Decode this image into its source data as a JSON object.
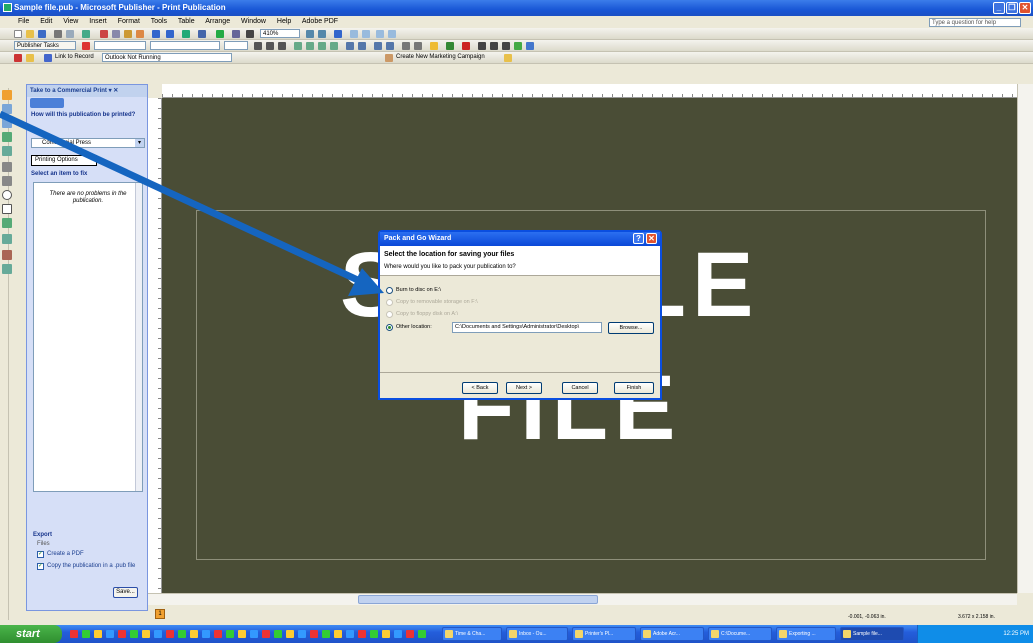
{
  "window": {
    "title": "Sample file.pub - Microsoft Publisher - Print Publication"
  },
  "menu": [
    "File",
    "Edit",
    "View",
    "Insert",
    "Format",
    "Tools",
    "Table",
    "Arrange",
    "Window",
    "Help",
    "Adobe PDF"
  ],
  "help_box": {
    "placeholder": "Type a question for help"
  },
  "toolbar": {
    "zoom": "410%",
    "publisher_tasks": "Publisher Tasks",
    "link_to_record": "Link to Record",
    "outlook_status": "Outlook Not Running",
    "create_campaign": "Create New Marketing Campaign"
  },
  "task_pane": {
    "title": "Take to a Commercial Print",
    "question": "How will this publication be printed?",
    "print_method": "Commercial Press",
    "printing_options": "Printing Options",
    "select_item": "Select an item to fix",
    "no_problems": "There are no problems in the publication.",
    "export_heading": "Export",
    "files_label": "Files",
    "create_pdf": "Create a PDF",
    "copy_pub": "Copy the publication in a .pub file",
    "save_button": "Save..."
  },
  "canvas": {
    "line1": "SAMPLE",
    "line2": "FILE"
  },
  "status": {
    "position": "-0.001, -0.063 in.",
    "size": "3.672 x 2.158 in."
  },
  "dialog": {
    "title": "Pack and Go Wizard",
    "heading": "Select the location for saving your files",
    "subheading": "Where would you like to pack your publication to?",
    "options": [
      {
        "label": "Burn to disc on E:\\",
        "selected": false,
        "enabled": true
      },
      {
        "label": "Copy to removable storage on F:\\",
        "selected": false,
        "enabled": false
      },
      {
        "label": "Copy to floppy disk on A:\\",
        "selected": false,
        "enabled": false
      },
      {
        "label": "Other location:",
        "selected": true,
        "enabled": true
      }
    ],
    "path": "C:\\Documents and Settings\\Administrator\\Desktop\\",
    "browse": "Browse...",
    "back": "< Back",
    "next": "Next >",
    "cancel": "Cancel",
    "finish": "Finish"
  },
  "taskbar": {
    "start": "start",
    "tasks": [
      "Time & Cha...",
      "Inbox - Ou...",
      "Printer's Pl...",
      "Adobe Acr...",
      "C:\\Docume...",
      "Exporting ...",
      "Sample file..."
    ],
    "clock": "12:25 PM"
  },
  "colors": {
    "canvas_bg": "#4a4d36",
    "title_blue": "#0a48d8",
    "arrow_blue": "#1565c0"
  }
}
